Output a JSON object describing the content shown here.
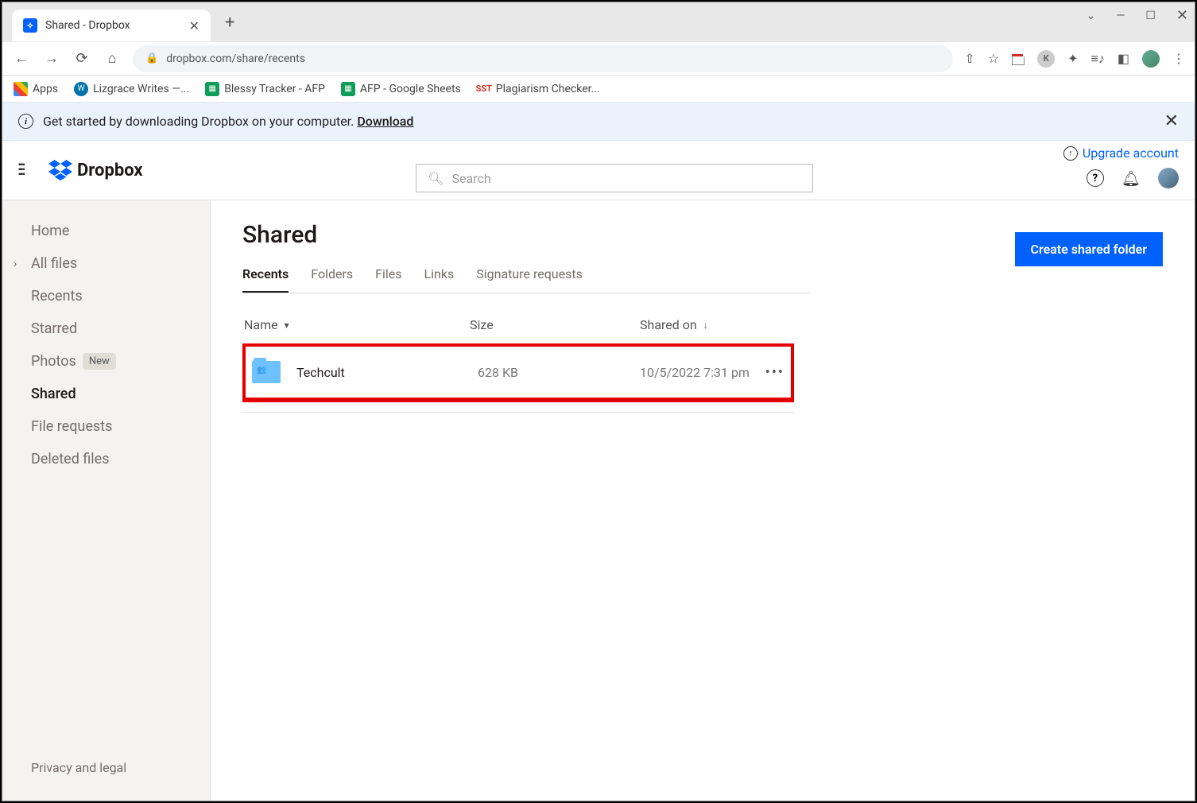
{
  "browser": {
    "tab_title": "Shared - Dropbox",
    "url": "dropbox.com/share/recents",
    "bookmarks": [
      {
        "label": "Apps",
        "icon": "apps"
      },
      {
        "label": "Lizgrace Writes —...",
        "icon": "wp"
      },
      {
        "label": "Blessy Tracker - AFP",
        "icon": "sheets"
      },
      {
        "label": "AFP - Google Sheets",
        "icon": "sheets"
      },
      {
        "label": "Plagiarism Checker...",
        "icon": "sst"
      }
    ],
    "profile_initial": "K"
  },
  "banner": {
    "text": "Get started by downloading Dropbox on your computer. ",
    "link": "Download"
  },
  "header": {
    "brand": "Dropbox",
    "search_placeholder": "Search",
    "upgrade_label": "Upgrade account"
  },
  "sidebar": {
    "items": [
      {
        "label": "Home"
      },
      {
        "label": "All files",
        "has_chevron": true
      },
      {
        "label": "Recents"
      },
      {
        "label": "Starred"
      },
      {
        "label": "Photos",
        "badge": "New"
      },
      {
        "label": "Shared",
        "active": true
      },
      {
        "label": "File requests"
      },
      {
        "label": "Deleted files"
      }
    ],
    "footer": "Privacy and legal"
  },
  "page": {
    "title": "Shared",
    "create_button": "Create shared folder",
    "tabs": [
      {
        "label": "Recents",
        "active": true
      },
      {
        "label": "Folders"
      },
      {
        "label": "Files"
      },
      {
        "label": "Links"
      },
      {
        "label": "Signature requests"
      }
    ],
    "columns": {
      "name": "Name",
      "size": "Size",
      "shared_on": "Shared on"
    },
    "rows": [
      {
        "name": "Techcult",
        "size": "628 KB",
        "shared_on": "10/5/2022 7:31 pm"
      }
    ]
  }
}
